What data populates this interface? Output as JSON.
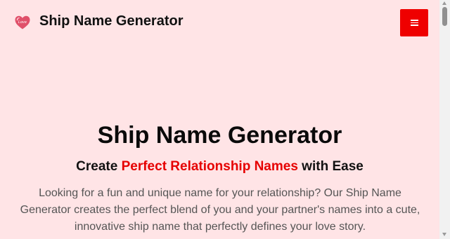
{
  "header": {
    "brand": "Ship Name Generator",
    "logo_icon": "heart-love-icon",
    "menu_icon": "hamburger-menu-icon",
    "menu_button_color": "#ef0000"
  },
  "hero": {
    "title": "Ship Name Generator",
    "subtitle_prefix": "Create ",
    "subtitle_highlight": "Perfect Relationship Names",
    "subtitle_suffix": " with Ease",
    "description": "Looking for a fun and unique name for your relationship? Our Ship Name Generator creates the perfect blend of you and your partner's names into a cute, innovative ship name that perfectly defines your love story."
  },
  "colors": {
    "background": "#ffe4e6",
    "accent": "#e60000"
  }
}
